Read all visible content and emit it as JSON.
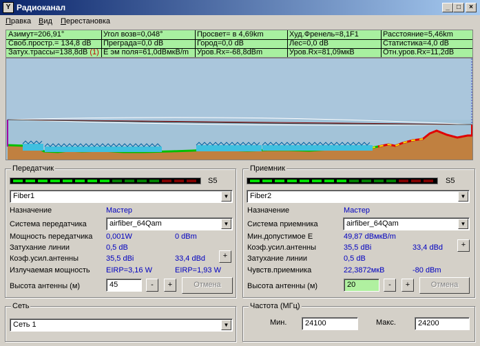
{
  "window": {
    "title": "Радиоканал",
    "icon": "antenna-icon",
    "controls": [
      "minimize-icon",
      "maximize-icon",
      "close-icon"
    ]
  },
  "menu": [
    {
      "pre": "",
      "u": "П",
      "post": "равка"
    },
    {
      "pre": "",
      "u": "В",
      "post": "ид"
    },
    {
      "pre": "",
      "u": "П",
      "post": "ерестановка"
    }
  ],
  "info": {
    "row1": [
      "Азимут=206,91°",
      "Угол возв=0,048°",
      "Просвет= в 4,69km",
      "Худ.Френель=8,1F1",
      "Расстояние=5,46km"
    ],
    "row2": [
      "Своб.простр.= 134,8 dB",
      "Преграда=0,0 dB",
      "Город=0,0 dB",
      "Лес=0,0 dB",
      "Статистика=4,0 dB"
    ],
    "row3": [
      "Затух.трассы=138,8dB",
      "Е эм поля=61,0dBмкВ/m",
      "Уров.Rx=-68,8dBm",
      "Уров.Rx=81,09мкВ",
      "Отн.уров.Rx=11,2dB"
    ],
    "row3_flag": "(1)"
  },
  "transmitter": {
    "group_title": "Передатчик",
    "meter_label": "S5",
    "device": "Fiber1",
    "assignment_label": "Назначение",
    "assignment_value": "Мастер",
    "system_label": "Система передатчика",
    "system_value": "airfiber_64Qam",
    "power_label": "Мощность передатчика",
    "power_w": "0,001W",
    "power_dbm": "0 dBm",
    "loss_label": "Затухание линии",
    "loss_value": "0,5 dB",
    "gain_label": "Коэф.усил.антенны",
    "gain_dbi": "35,5 dBi",
    "gain_dbd": "33,4 dBd",
    "plus": "+",
    "eirp_label": "Излучаемая мощность",
    "eirp_value": "EIRP=3,16 W",
    "erp_value": "EIRP=1,93 W",
    "height_label": "Высота антенны (м)",
    "height_value": "45",
    "minus": "-",
    "cancel": "Отмена"
  },
  "receiver": {
    "group_title": "Приемник",
    "meter_label": "S5",
    "device": "Fiber2",
    "assignment_label": "Назначение",
    "assignment_value": "Мастер",
    "system_label": "Система приемника",
    "system_value": "airfiber_64Qam",
    "min_e_label": "Мин.допустимое Е",
    "min_e_value": "49,87 dBмкВ/m",
    "gain_label": "Коэф.усил.антенны",
    "gain_dbi": "35,5 dBi",
    "gain_dbd": "33,4 dBd",
    "plus": "+",
    "loss_label": "Затухание линии",
    "loss_value": "0,5 dB",
    "sens_label": "Чувств.приемника",
    "sens_uv": "22,3872мкВ",
    "sens_dbm": "-80 dBm",
    "height_label": "Высота антенны (м)",
    "height_value": "20",
    "minus": "-",
    "cancel": "Отмена"
  },
  "network": {
    "group_title": "Сеть",
    "value": "Сеть  1"
  },
  "frequency": {
    "group_title": "Частота (МГц)",
    "min_label": "Мин.",
    "min_value": "24100",
    "max_label": "Макс.",
    "max_value": "24200"
  },
  "meter_pattern": [
    "green",
    "green",
    "green",
    "green",
    "green",
    "green",
    "green",
    "green",
    "darkgreen",
    "darkgreen",
    "darkgreen",
    "darkgreen",
    "darkred",
    "darkred",
    "darkred"
  ],
  "colors": {
    "info_bg": "#a8f0a0",
    "sky": "#a3c3d8",
    "terrain": "#c08040",
    "green_seg": "#00e000",
    "darkgreen_seg": "#008000",
    "darkred_seg": "#800000",
    "value_blue": "#0000c0"
  }
}
